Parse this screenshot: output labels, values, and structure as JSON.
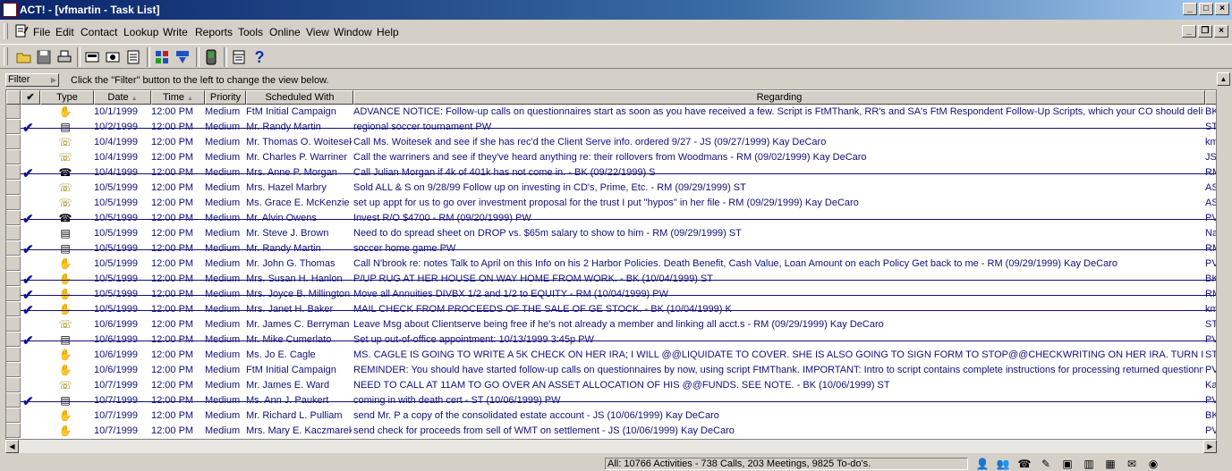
{
  "window": {
    "title": "ACT! - [vfmartin - Task List]",
    "buttons": [
      "_",
      "□",
      "×"
    ],
    "mdi_buttons": [
      "_",
      "❐",
      "×"
    ]
  },
  "menu": [
    {
      "label": "File"
    },
    {
      "label": "Edit"
    },
    {
      "label": "Contact"
    },
    {
      "label": "Lookup"
    },
    {
      "label": "Write"
    },
    {
      "label": "Reports"
    },
    {
      "label": "Tools"
    },
    {
      "label": "Online"
    },
    {
      "label": "View"
    },
    {
      "label": "Window"
    },
    {
      "label": "Help"
    }
  ],
  "toolbar": {
    "icons": [
      "open-folder-icon",
      "save-icon",
      "print-icon",
      "phone-list-icon",
      "contact-window-icon",
      "task-list-icon",
      "lookup-icon",
      "download-icon",
      "palm-icon",
      "calendar-icon",
      "help-icon"
    ],
    "help_glyph": "?"
  },
  "filter": {
    "label": "Filter",
    "message": "Click the \"Filter\" button to the left to change the view below."
  },
  "columns": {
    "check": "✔",
    "type": "Type",
    "date": "Date",
    "time": "Time",
    "priority": "Priority",
    "scheduled_with": "Scheduled With",
    "regarding": "Regarding"
  },
  "rows": [
    {
      "done": false,
      "type": "todo",
      "date": "10/1/1999",
      "time": "12:00 PM",
      "priority": "Medium",
      "with": "FtM Initial Campaign",
      "regarding": "ADVANCE NOTICE: Follow-up calls on questionnaires start as soon as you have received a few.  Script is FtMThank, RR's and SA's FtM Respondent Follow-Up Scripts, which your CO should deliver to y",
      "extra": "BK"
    },
    {
      "done": true,
      "type": "meeting",
      "date": "10/2/1999",
      "time": "12:00 PM",
      "priority": "Medium",
      "with": "Mr. Randy Martin",
      "regarding": "regional soccer tournament PW",
      "extra": "ST"
    },
    {
      "done": false,
      "type": "call",
      "date": "10/4/1999",
      "time": "12:00 PM",
      "priority": "Medium",
      "with": "Mr. Thomas O. Woitesek",
      "regarding": "Call Ms. Woitesek and see if she has rec'd the Client Serve info. ordered 9/27 - JS (09/27/1999) Kay DeCaro",
      "extra": "km"
    },
    {
      "done": false,
      "type": "call",
      "date": "10/4/1999",
      "time": "12:00 PM",
      "priority": "Medium",
      "with": "Mr. Charles P. Warriner",
      "regarding": "Call the warriners and see if they've heard anything re: their rollovers from Woodmans - RM (09/02/1999) Kay DeCaro",
      "extra": "JS"
    },
    {
      "done": true,
      "type": "phone",
      "date": "10/4/1999",
      "time": "12:00 PM",
      "priority": "Medium",
      "with": "Mrs. Anne P. Morgan",
      "regarding": "Call Julian Morgan if 4k of 401k has not come in. - BK (09/22/1999) S",
      "extra": "RM"
    },
    {
      "done": false,
      "type": "call",
      "date": "10/5/1999",
      "time": "12:00 PM",
      "priority": "Medium",
      "with": "Mrs. Hazel Marbry",
      "regarding": "Sold ALL & S on 9/28/99 Follow up on investing in CD's, Prime, Etc. - RM (09/29/1999) ST",
      "extra": "AS"
    },
    {
      "done": false,
      "type": "call",
      "date": "10/5/1999",
      "time": "12:00 PM",
      "priority": "Medium",
      "with": "Ms. Grace E. McKenzie",
      "regarding": "set up appt for us to go over investment proposal for the trust I put \"hypos\" in her file - RM (09/29/1999) Kay DeCaro",
      "extra": "AS"
    },
    {
      "done": true,
      "type": "phone",
      "date": "10/5/1999",
      "time": "12:00 PM",
      "priority": "Medium",
      "with": "Mr. Alvin Owens",
      "regarding": "Invest R/O $4700 - RM (09/20/1999) PW",
      "extra": "PV"
    },
    {
      "done": false,
      "type": "meeting",
      "date": "10/5/1999",
      "time": "12:00 PM",
      "priority": "Medium",
      "with": "Mr. Steve J. Brown",
      "regarding": "Need to do  spread sheet on DROP vs. $65m salary to show to him - RM (09/29/1999) ST",
      "extra": "Na"
    },
    {
      "done": true,
      "type": "meeting",
      "date": "10/5/1999",
      "time": "12:00 PM",
      "priority": "Medium",
      "with": "Mr. Randy Martin",
      "regarding": "soccer home game PW",
      "extra": "RM"
    },
    {
      "done": false,
      "type": "todo",
      "date": "10/5/1999",
      "time": "12:00 PM",
      "priority": "Medium",
      "with": "Mr. John G. Thomas",
      "regarding": "Call N'brook re: notes Talk to April on this Info on his 2 Harbor Policies.  Death Benefit, Cash Value, Loan Amount on each Policy Get back to me - RM (09/29/1999) Kay DeCaro",
      "extra": "PV"
    },
    {
      "done": true,
      "type": "todo",
      "date": "10/5/1999",
      "time": "12:00 PM",
      "priority": "Medium",
      "with": "Mrs. Susan H. Hanlon",
      "regarding": "P/UP RUG AT HER HOUSE ON WAY HOME FROM WORK. - BK (10/04/1999) ST",
      "extra": "BK"
    },
    {
      "done": true,
      "type": "todo",
      "date": "10/5/1999",
      "time": "12:00 PM",
      "priority": "Medium",
      "with": "Mrs. Joyce B. Millington",
      "regarding": "Move all Annuities DIVBX 1/2 and 1/2 to EQUITY - RM (10/04/1999) PW",
      "extra": "RM"
    },
    {
      "done": true,
      "type": "todo",
      "date": "10/5/1999",
      "time": "12:00 PM",
      "priority": "Medium",
      "with": "Mrs. Janet H. Baker",
      "regarding": "MAIL CHECK FROM PROCEEDS OF THE SALE OF GE STOCK. - BK (10/04/1999) K",
      "extra": "km"
    },
    {
      "done": false,
      "type": "call",
      "date": "10/6/1999",
      "time": "12:00 PM",
      "priority": "Medium",
      "with": "Mr. James C. Berryman",
      "regarding": "Leave Msg about Clientserve being free if he's  not already a member and linking all acct.s - RM (09/29/1999) Kay DeCaro",
      "extra": "ST"
    },
    {
      "done": true,
      "type": "meeting",
      "date": "10/6/1999",
      "time": "12:00 PM",
      "priority": "Medium",
      "with": "Mr. Mike Cumerlato",
      "regarding": "Set up out-of-office appointment: 10/13/1999 3:45p PW",
      "extra": "PV"
    },
    {
      "done": false,
      "type": "todo",
      "date": "10/6/1999",
      "time": "12:00 PM",
      "priority": "Medium",
      "with": "Ms. Jo E. Cagle",
      "regarding": "MS. CAGLE IS GOING TO WRITE A 5K CHECK ON HER IRA; I WILL @@LIQUIDATE TO COVER. SHE IS ALSO GOING TO SIGN FORM TO STOP@@CHECKWRITING ON HER IRA. TURN IN F(",
      "extra": "ST"
    },
    {
      "done": false,
      "type": "todo",
      "date": "10/6/1999",
      "time": "12:00 PM",
      "priority": "Medium",
      "with": "FtM Initial Campaign",
      "regarding": "REMINDER: You should have started follow-up calls on questionnaires by now, using script FtMThank.  IMPORTANT: Intro to script contains complete instructions for processing returned questionnaires",
      "extra": "PV"
    },
    {
      "done": false,
      "type": "call",
      "date": "10/7/1999",
      "time": "12:00 PM",
      "priority": "Medium",
      "with": "Mr. James E. Ward",
      "regarding": "NEED TO CALL AT 11AM TO GO OVER AN ASSET ALLOCATION OF HIS @@FUNDS. SEE NOTE. - BK (10/06/1999) ST",
      "extra": "Ka"
    },
    {
      "done": true,
      "type": "meeting",
      "date": "10/7/1999",
      "time": "12:00 PM",
      "priority": "Medium",
      "with": "Ms. Ann J. Paukert",
      "regarding": "coming in with death cert - ST (10/06/1999) PW",
      "extra": "PV"
    },
    {
      "done": false,
      "type": "todo",
      "date": "10/7/1999",
      "time": "12:00 PM",
      "priority": "Medium",
      "with": "Mr. Richard L. Pulliam",
      "regarding": "send Mr. P a copy of the consolidated estate account - JS (10/06/1999) Kay DeCaro",
      "extra": "BK"
    },
    {
      "done": false,
      "type": "todo",
      "date": "10/7/1999",
      "time": "12:00 PM",
      "priority": "Medium",
      "with": "Mrs. Mary E. Kaczmarek",
      "regarding": "send check for proceeds from sell of WMT on settlement - JS (10/06/1999) Kay DeCaro",
      "extra": "PV"
    }
  ],
  "status": {
    "text": "All: 10766 Activities - 738 Calls, 203 Meetings, 9825 To-do's.",
    "icons": [
      "contacts-icon",
      "groups-icon",
      "phone-list-icon",
      "write-icon",
      "day-view-icon",
      "week-view-icon",
      "month-view-icon",
      "task-list-icon",
      "internet-icon"
    ]
  },
  "colors": {
    "row_text": "#10107a",
    "title_start": "#0a246a",
    "title_end": "#a6caf0"
  }
}
